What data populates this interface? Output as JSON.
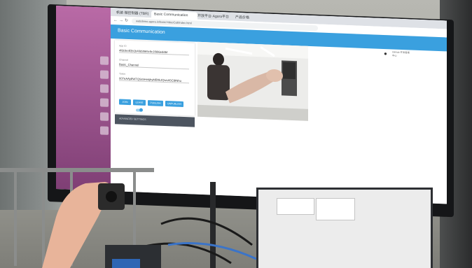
{
  "page": {
    "header_title": "Basic Communication",
    "tabs": [
      "帆彼·微控制器 (TBR)",
      "Basic Communication",
      "开放平台·Agora平台",
      "产品价格"
    ],
    "url": "webdemo.agora.io/basicVideoCall/index.html"
  },
  "form": {
    "appid_label": "App ID",
    "appid_value": "4fdc0e4f2b1b40d3b65c9c1f996eddbf",
    "channel_label": "Channel",
    "channel_value": "Basic_Channel",
    "token_label": "Token",
    "token_value": "007eAAj4fWTQ5s5HvkjhyMBhkJQwxA5C8tNhu",
    "buttons": [
      "JOIN",
      "LEAVE",
      "PUBLISH",
      "UNPUBLISH"
    ],
    "advanced_label": "ADVANCED SETTINGS"
  },
  "github": {
    "icon": "github-icon",
    "text": "GitHub 开发者者中心"
  },
  "colors": {
    "accent": "#3aa0df",
    "section_bar": "#4d5560"
  }
}
